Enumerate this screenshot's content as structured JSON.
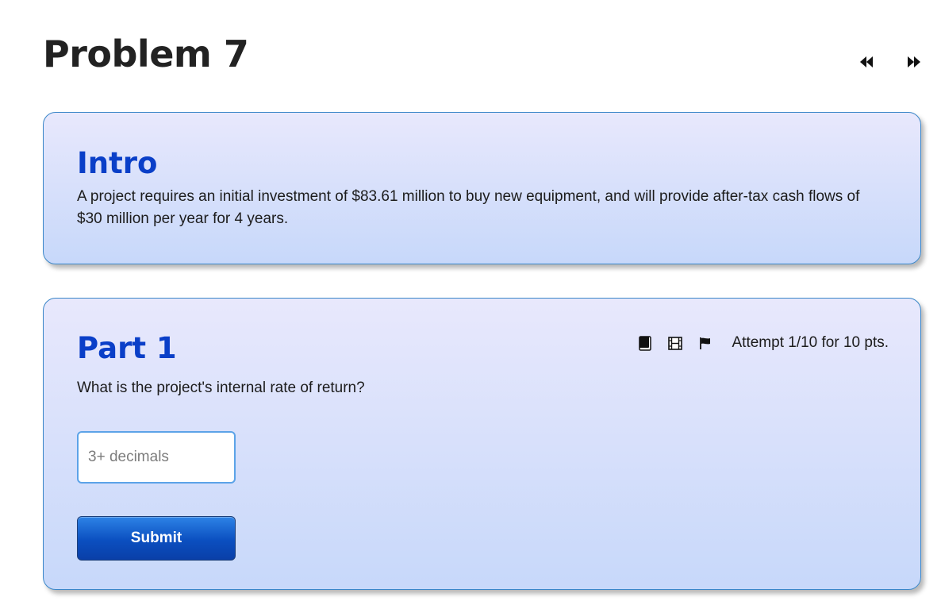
{
  "page": {
    "title": "Problem 7"
  },
  "nav": {
    "prev_icon": "rewind-icon",
    "next_icon": "fast-forward-icon"
  },
  "intro": {
    "heading": "Intro",
    "text": "A project requires an initial investment of $83.61 million to buy new equipment, and will provide after-tax cash flows of $30 million per year for 4 years."
  },
  "part1": {
    "heading": "Part 1",
    "question": "What is the project's internal rate of return?",
    "tools": [
      "book-icon",
      "film-icon",
      "flag-icon"
    ],
    "attempt": "Attempt 1/10 for 10 pts.",
    "input": {
      "value": "",
      "placeholder": "3+ decimals"
    },
    "submit_label": "Submit"
  },
  "colors": {
    "heading": "#0a3fc8",
    "card_border": "#3a86c8",
    "card_gradient_top": "#e8e8fc",
    "card_gradient_bottom": "#c7d8fa",
    "button": "#0b4fc0",
    "input_border": "#5ca3e8"
  }
}
